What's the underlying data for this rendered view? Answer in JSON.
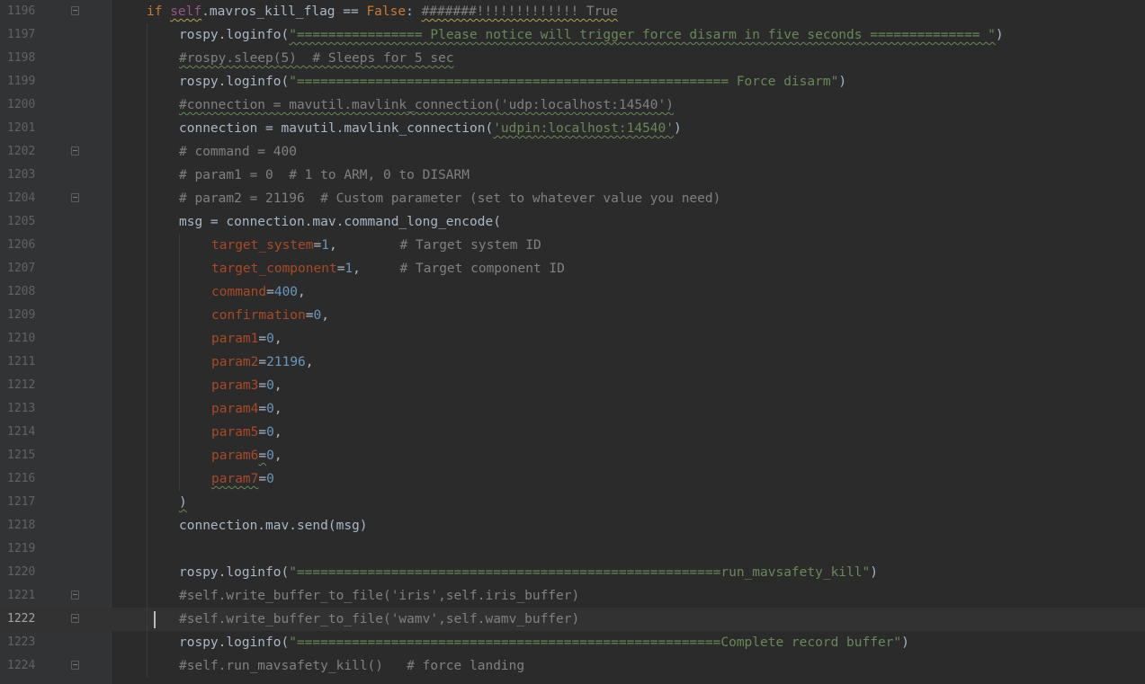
{
  "editor": {
    "current_line": "1222",
    "lines": [
      {
        "num": "1196",
        "fold": true,
        "segs": [
          {
            "t": "if ",
            "c": "kw"
          },
          {
            "t": "self",
            "c": "self"
          },
          {
            "t": ".mavros_kill_flag == "
          },
          {
            "t": "False",
            "c": "kw"
          },
          {
            "t": ": "
          },
          {
            "t": "#######!!!!!!!!!!!!! True",
            "c": "cmt"
          }
        ]
      },
      {
        "num": "1197",
        "segs": [
          {
            "t": "rospy.loginfo("
          },
          {
            "t": "\"================ Please notice will trigger force disarm in five seconds ============== \"",
            "c": "str"
          },
          {
            "t": ")"
          }
        ]
      },
      {
        "num": "1198",
        "segs": [
          {
            "t": "#rospy.sleep(5)  # Sleeps for 5 sec",
            "c": "cmt"
          }
        ]
      },
      {
        "num": "1199",
        "segs": [
          {
            "t": "rospy.loginfo("
          },
          {
            "t": "\"======================================================= Force disarm\"",
            "c": "str"
          },
          {
            "t": ")"
          }
        ]
      },
      {
        "num": "1200",
        "segs": [
          {
            "t": "#connection = mavutil.mavlink_connection('udp:localhost:14540')",
            "c": "cmt"
          }
        ]
      },
      {
        "num": "1201",
        "segs": [
          {
            "t": "connection = mavutil.mavlink_connection("
          },
          {
            "t": "'udpin:localhost:14540'",
            "c": "str"
          },
          {
            "t": ")"
          }
        ]
      },
      {
        "num": "1202",
        "fold": true,
        "segs": [
          {
            "t": "# command = 400",
            "c": "cmt"
          }
        ]
      },
      {
        "num": "1203",
        "segs": [
          {
            "t": "# param1 = 0  # 1 to ARM, 0 to DISARM",
            "c": "cmt"
          }
        ]
      },
      {
        "num": "1204",
        "fold": true,
        "segs": [
          {
            "t": "# param2 = 21196  # Custom parameter (set to whatever value you need)",
            "c": "cmt"
          }
        ]
      },
      {
        "num": "1205",
        "segs": [
          {
            "t": "msg = connection.mav.command_long_encode("
          }
        ]
      },
      {
        "num": "1206",
        "segs": [
          {
            "t": "target_system",
            "c": "param"
          },
          {
            "t": "="
          },
          {
            "t": "1",
            "c": "num-lit"
          },
          {
            "t": ",        "
          },
          {
            "t": "# Target system ID",
            "c": "cmt"
          }
        ]
      },
      {
        "num": "1207",
        "segs": [
          {
            "t": "target_component",
            "c": "param"
          },
          {
            "t": "="
          },
          {
            "t": "1",
            "c": "num-lit"
          },
          {
            "t": ",     "
          },
          {
            "t": "# Target component ID",
            "c": "cmt"
          }
        ]
      },
      {
        "num": "1208",
        "segs": [
          {
            "t": "command",
            "c": "param"
          },
          {
            "t": "="
          },
          {
            "t": "400",
            "c": "num-lit"
          },
          {
            "t": ","
          }
        ]
      },
      {
        "num": "1209",
        "segs": [
          {
            "t": "confirmation",
            "c": "param"
          },
          {
            "t": "="
          },
          {
            "t": "0",
            "c": "num-lit"
          },
          {
            "t": ","
          }
        ]
      },
      {
        "num": "1210",
        "segs": [
          {
            "t": "param1",
            "c": "param"
          },
          {
            "t": "="
          },
          {
            "t": "0",
            "c": "num-lit"
          },
          {
            "t": ","
          }
        ]
      },
      {
        "num": "1211",
        "segs": [
          {
            "t": "param2",
            "c": "param"
          },
          {
            "t": "="
          },
          {
            "t": "21196",
            "c": "num-lit"
          },
          {
            "t": ","
          }
        ]
      },
      {
        "num": "1212",
        "segs": [
          {
            "t": "param3",
            "c": "param"
          },
          {
            "t": "="
          },
          {
            "t": "0",
            "c": "num-lit"
          },
          {
            "t": ","
          }
        ]
      },
      {
        "num": "1213",
        "segs": [
          {
            "t": "param4",
            "c": "param"
          },
          {
            "t": "="
          },
          {
            "t": "0",
            "c": "num-lit"
          },
          {
            "t": ","
          }
        ]
      },
      {
        "num": "1214",
        "segs": [
          {
            "t": "param5",
            "c": "param"
          },
          {
            "t": "="
          },
          {
            "t": "0",
            "c": "num-lit"
          },
          {
            "t": ","
          }
        ]
      },
      {
        "num": "1215",
        "segs": [
          {
            "t": "param6",
            "c": "param"
          },
          {
            "t": "="
          },
          {
            "t": "0",
            "c": "num-lit"
          },
          {
            "t": ","
          }
        ]
      },
      {
        "num": "1216",
        "segs": [
          {
            "t": "param7",
            "c": "param"
          },
          {
            "t": "="
          },
          {
            "t": "0",
            "c": "num-lit"
          }
        ]
      },
      {
        "num": "1217",
        "segs": [
          {
            "t": ")"
          }
        ]
      },
      {
        "num": "1218",
        "segs": [
          {
            "t": "connection.mav.send(msg)"
          }
        ]
      },
      {
        "num": "1219",
        "segs": []
      },
      {
        "num": "1220",
        "segs": [
          {
            "t": "rospy.loginfo("
          },
          {
            "t": "\"======================================================run_mavsafety_kill\"",
            "c": "str"
          },
          {
            "t": ")"
          }
        ]
      },
      {
        "num": "1221",
        "fold": true,
        "segs": [
          {
            "t": "#self.write_buffer_to_file('iris',self.iris_buffer)",
            "c": "cmt"
          }
        ]
      },
      {
        "num": "1222",
        "fold": true,
        "segs": [
          {
            "t": "#self.write_buffer_to_file('wamv',self.wamv_buffer)",
            "c": "cmt"
          }
        ]
      },
      {
        "num": "1223",
        "segs": [
          {
            "t": "rospy.loginfo("
          },
          {
            "t": "\"======================================================Complete record buffer\"",
            "c": "str"
          },
          {
            "t": ")"
          }
        ]
      },
      {
        "num": "1224",
        "fold": true,
        "segs": [
          {
            "t": "#self.run_mavsafety_kill()   # force landing",
            "c": "cmt"
          }
        ]
      }
    ]
  }
}
